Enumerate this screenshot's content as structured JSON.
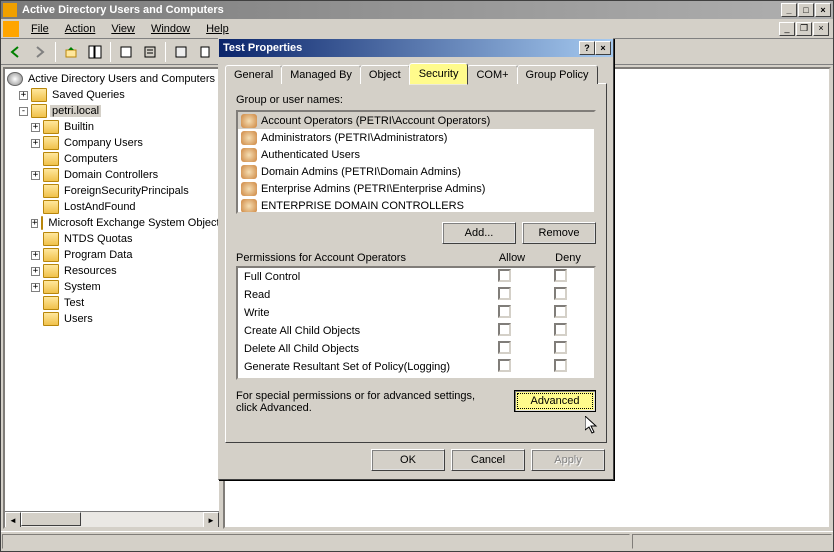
{
  "window": {
    "title": "Active Directory Users and Computers"
  },
  "menu": {
    "file": "File",
    "action": "Action",
    "view": "View",
    "window": "Window",
    "help": "Help"
  },
  "tree": {
    "root": "Active Directory Users and Computers",
    "saved_queries": "Saved Queries",
    "domain": "petri.local",
    "nodes": [
      "Builtin",
      "Company Users",
      "Computers",
      "Domain Controllers",
      "ForeignSecurityPrincipals",
      "LostAndFound",
      "Microsoft Exchange System Objects",
      "NTDS Quotas",
      "Program Data",
      "Resources",
      "System",
      "Test",
      "Users"
    ]
  },
  "dialog": {
    "title": "Test Properties",
    "tabs": {
      "general": "General",
      "managed_by": "Managed By",
      "object": "Object",
      "security": "Security",
      "com_plus": "COM+",
      "group_policy": "Group Policy"
    },
    "group_label": "Group or user names:",
    "groups": [
      "Account Operators (PETRI\\Account Operators)",
      "Administrators (PETRI\\Administrators)",
      "Authenticated Users",
      "Domain Admins (PETRI\\Domain Admins)",
      "Enterprise Admins (PETRI\\Enterprise Admins)",
      "ENTERPRISE DOMAIN CONTROLLERS"
    ],
    "add_btn": "Add...",
    "remove_btn": "Remove",
    "perm_label": "Permissions for Account Operators",
    "allow": "Allow",
    "deny": "Deny",
    "permissions": [
      "Full Control",
      "Read",
      "Write",
      "Create All Child Objects",
      "Delete All Child Objects",
      "Generate Resultant Set of Policy(Logging)"
    ],
    "special_text1": "For special permissions or for advanced settings,",
    "special_text2": "click Advanced.",
    "advanced_btn": "Advanced",
    "ok": "OK",
    "cancel": "Cancel",
    "apply": "Apply"
  }
}
